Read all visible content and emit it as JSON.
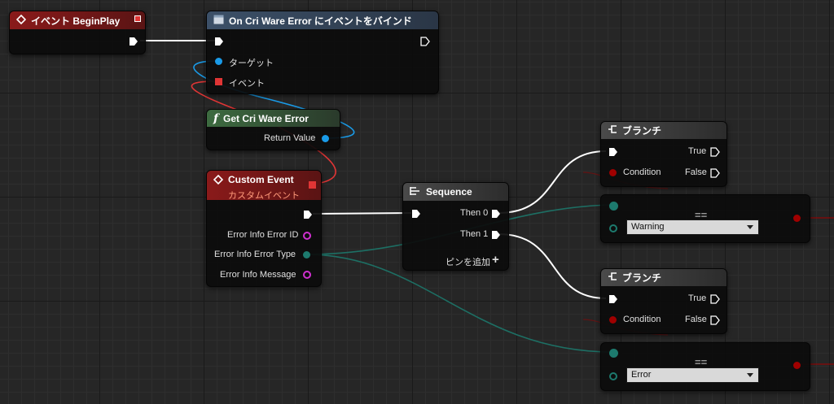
{
  "nodes": {
    "beginplay": {
      "title": "イベント BeginPlay"
    },
    "bind": {
      "title": "On Cri Ware Error にイベントをバインド",
      "target_label": "ターゲット",
      "event_label": "イベント"
    },
    "get_error": {
      "title": "Get Cri Ware Error",
      "return_label": "Return Value"
    },
    "custom_event": {
      "title": "Custom Event",
      "subtitle": "カスタムイベント",
      "outputs": [
        "Error Info Error ID",
        "Error Info Error Type",
        "Error Info Message"
      ]
    },
    "sequence": {
      "title": "Sequence",
      "then0": "Then 0",
      "then1": "Then 1",
      "add_pin": "ピンを追加"
    },
    "branch1": {
      "title": "ブランチ",
      "true_label": "True",
      "condition_label": "Condition",
      "false_label": "False"
    },
    "branch2": {
      "title": "ブランチ",
      "true_label": "True",
      "condition_label": "Condition",
      "false_label": "False"
    },
    "equal1": {
      "symbol": "==",
      "value": "Warning"
    },
    "equal2": {
      "symbol": "==",
      "value": "Error"
    }
  },
  "colors": {
    "event_header": "#8a1a1a",
    "bind_header": "#3c5068",
    "function_header": "#3d6b40",
    "custom_event_header": "#8a1a1a",
    "neutral_header": "#3a3a3a",
    "exec_wire": "#ffffff",
    "object_pin": "#1a9be8",
    "delegate_pin": "#e03535",
    "bool_pin": "#a00000",
    "enum_pin": "#1d7a6e",
    "struct_pin": "#d030d0"
  },
  "icons": [
    "event-diamond-icon",
    "function-f-icon",
    "sequence-icon",
    "branch-icon",
    "plus-icon"
  ]
}
